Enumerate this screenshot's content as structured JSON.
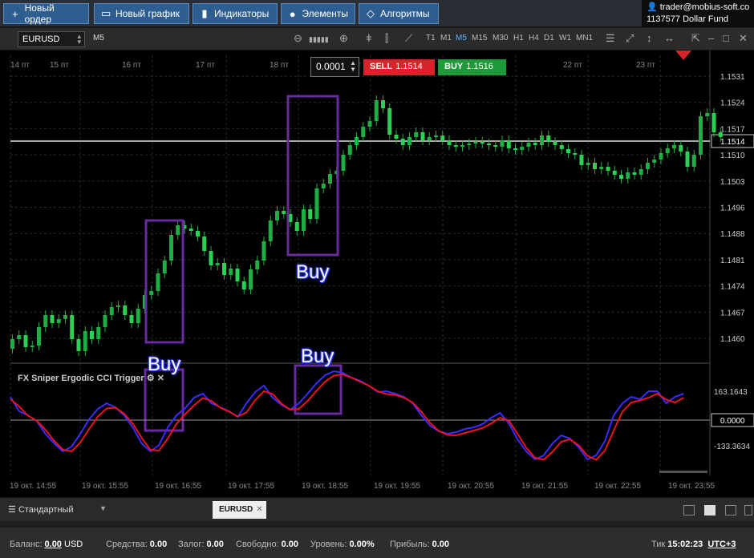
{
  "toolbar": {
    "new_order": "Новый ордер",
    "new_chart": "Новый график",
    "indicators": "Индикаторы",
    "elements": "Элементы",
    "algorithms": "Алгоритмы"
  },
  "account": {
    "email": "trader@mobius-soft.com",
    "id": "1137577",
    "name": "Dollar Fund"
  },
  "chart_toolbar": {
    "symbol": "EURUSD",
    "timeframe": "M5",
    "timeframes": [
      "T1",
      "M1",
      "M5",
      "M15",
      "M30",
      "H1",
      "H4",
      "D1",
      "W1",
      "MN1"
    ],
    "active_timeframe": "M5"
  },
  "trade": {
    "volume": "0.0001",
    "sell_label": "SELL",
    "sell_price": "1.1514",
    "buy_label": "BUY",
    "buy_price": "1.1516"
  },
  "annotations": {
    "buy1": "Buy",
    "buy2": "Buy",
    "buy3": "Buy"
  },
  "indicator": {
    "title": "FX Sniper Ergodic CCI Trigger"
  },
  "chart_data": {
    "type": "candlestick",
    "symbol": "EURUSD",
    "timeframe": "M5",
    "y_ticks": [
      "1.1531",
      "1.1524",
      "1.1517",
      "1.1510",
      "1.1503",
      "1.1496",
      "1.1488",
      "1.1481",
      "1.1474",
      "1.1467",
      "1.1460"
    ],
    "current_price": "1.1514",
    "top_x_ticks": [
      "14 пт",
      "15 пт",
      "16 пт",
      "17 пт",
      "18 пт",
      "19 пт",
      "22 пт",
      "23 пт"
    ],
    "bottom_x_ticks": [
      "19 окт. 14:55",
      "19 окт. 15:55",
      "19 окт. 16:55",
      "19 окт. 17:55",
      "19 окт. 18:55",
      "19 окт. 19:55",
      "19 окт. 20:55",
      "19 окт. 21:55",
      "19 окт. 22:55",
      "19 окт. 23:55"
    ],
    "indicator_ticks": [
      "163.1643",
      "0.0000",
      "-133.3634"
    ],
    "colors": {
      "up": "#22c24a",
      "down": "#22c24a",
      "fast_line": "#3a2bff",
      "slow_line": "#e8141c",
      "box": "#6a2aa0"
    }
  },
  "bottom": {
    "template": "Стандартный",
    "symbol_tab": "EURUSD"
  },
  "status": {
    "balance_label": "Баланс:",
    "balance": "0.00",
    "currency": "USD",
    "funds_label": "Средства:",
    "funds": "0.00",
    "margin_label": "Залог:",
    "margin": "0.00",
    "free_label": "Свободно:",
    "free": "0.00",
    "level_label": "Уровень:",
    "level": "0.00%",
    "profit_label": "Прибыль:",
    "profit": "0.00",
    "tick_label": "Тик",
    "time": "15:02:23",
    "tz": "UTC+3"
  }
}
